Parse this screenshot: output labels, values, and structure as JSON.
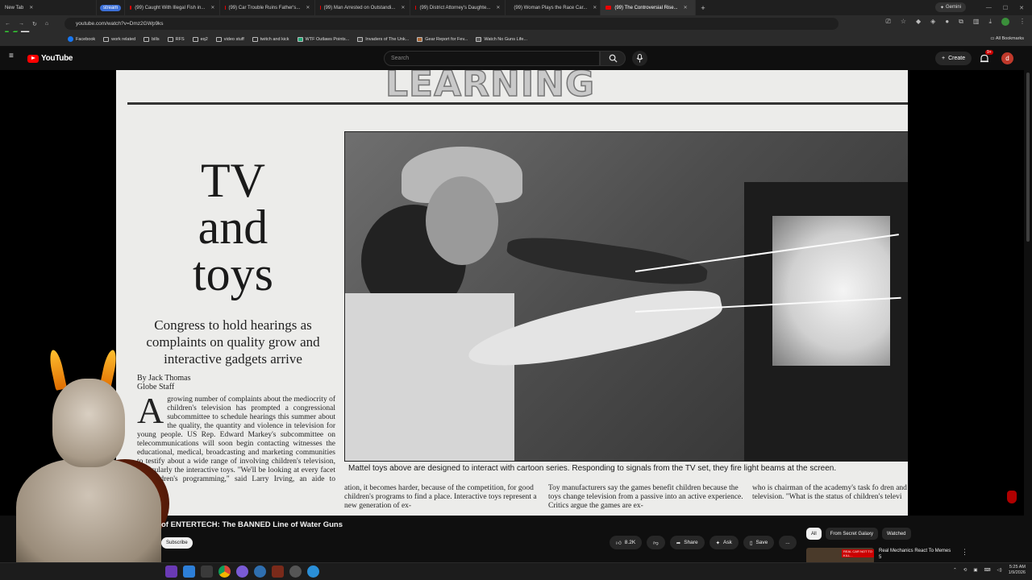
{
  "browser": {
    "tabs": [
      {
        "label": "New Tab",
        "active": false
      },
      {
        "label": "stream",
        "active": false
      },
      {
        "label": "(99) Caught With Illegal Fish in...",
        "active": false
      },
      {
        "label": "(99) Car Trouble Ruins Father's...",
        "active": false
      },
      {
        "label": "(99) Man Arrested on Outstandi...",
        "active": false
      },
      {
        "label": "(99) District Attorney's Daughte...",
        "active": false
      },
      {
        "label": "(99) Woman Plays the Race Car...",
        "active": false
      },
      {
        "label": "(99) The Controversial Rise...",
        "active": true
      }
    ],
    "gemini_label": "Gemini",
    "url": "youtube.com/watch?v=Dmz2GWp9ks",
    "bookmarks": [
      "Facebook",
      "work related",
      "bills",
      "RFS",
      "eq2",
      "video stuff",
      "twitch and kick",
      "WTF Outlaws Points...",
      "Invaders of The Unk...",
      "Gear Report for Fev...",
      "Watch No Guns Life..."
    ],
    "all_bookmarks": "All Bookmarks",
    "k5_music": "music"
  },
  "youtube": {
    "logo": "YouTube",
    "search_placeholder": "Search",
    "create_label": "Create",
    "notifications_badge": "9+",
    "profile_initial": "d"
  },
  "video_content": {
    "masthead": "LEARNING",
    "headline": "TV and toys",
    "headline_lines": [
      "TV",
      "and",
      "toys"
    ],
    "deck": "Congress to hold hearings as complaints on quality grow and interactive gadgets arrive",
    "byline_name": "By Jack Thomas",
    "byline_role": "Globe Staff",
    "dropcap": "A",
    "body_col1": "growing number of complaints about the mediocrity of children's television has prompted a congressional subcommittee to schedule hearings this summer about the quality, the quantity and violence in television for young people. US Rep. Edward Markey's subcommittee on telecommunications will soon begin contacting witnesses the educational, medical, broadcasting and marketing communities to testify about a wide range of involving children's television, particularly the interactive toys. \"We'll be looking at every facet of children's programming,\" said Larry Irving, an aide to Markey,",
    "caption": "Mattel toys above are designed to interact with cartoon series. Responding to signals from the TV set, they fire light beams at the screen.",
    "col2": "ation, it becomes harder, because of the competition, for good children's programs to find a place. Interactive toys represent a new generation of ex-",
    "col3": "Toy manufacturers say the games benefit children because the toys change television from a passive into an active experience. Critics argue the games are ex-",
    "col4": "who is chairman of the academy's task fo dren and television. \"What is the status of children's televi"
  },
  "video_meta": {
    "title": "of ENTERTECH: The BANNED Line of Water Guns",
    "subscribe_label": "Subscribe",
    "likes": "8.2K",
    "share_label": "Share",
    "ask_label": "Ask",
    "save_label": "Save",
    "more_label": "..."
  },
  "sidebar_chips": [
    "All",
    "From Secret Galaxy",
    "Watched"
  ],
  "recommended": [
    {
      "title": "Real Mechanics React To Memes 5",
      "thumb_text": "REAL CAR NOT TO KILL..."
    }
  ],
  "taskbar": {
    "time": "5:25 AM",
    "date": "1/9/2026"
  },
  "colors": {
    "yt_red": "#ff0000",
    "bg": "#0f0f0f",
    "paper": "#ececea",
    "profile": "#c0392b"
  }
}
